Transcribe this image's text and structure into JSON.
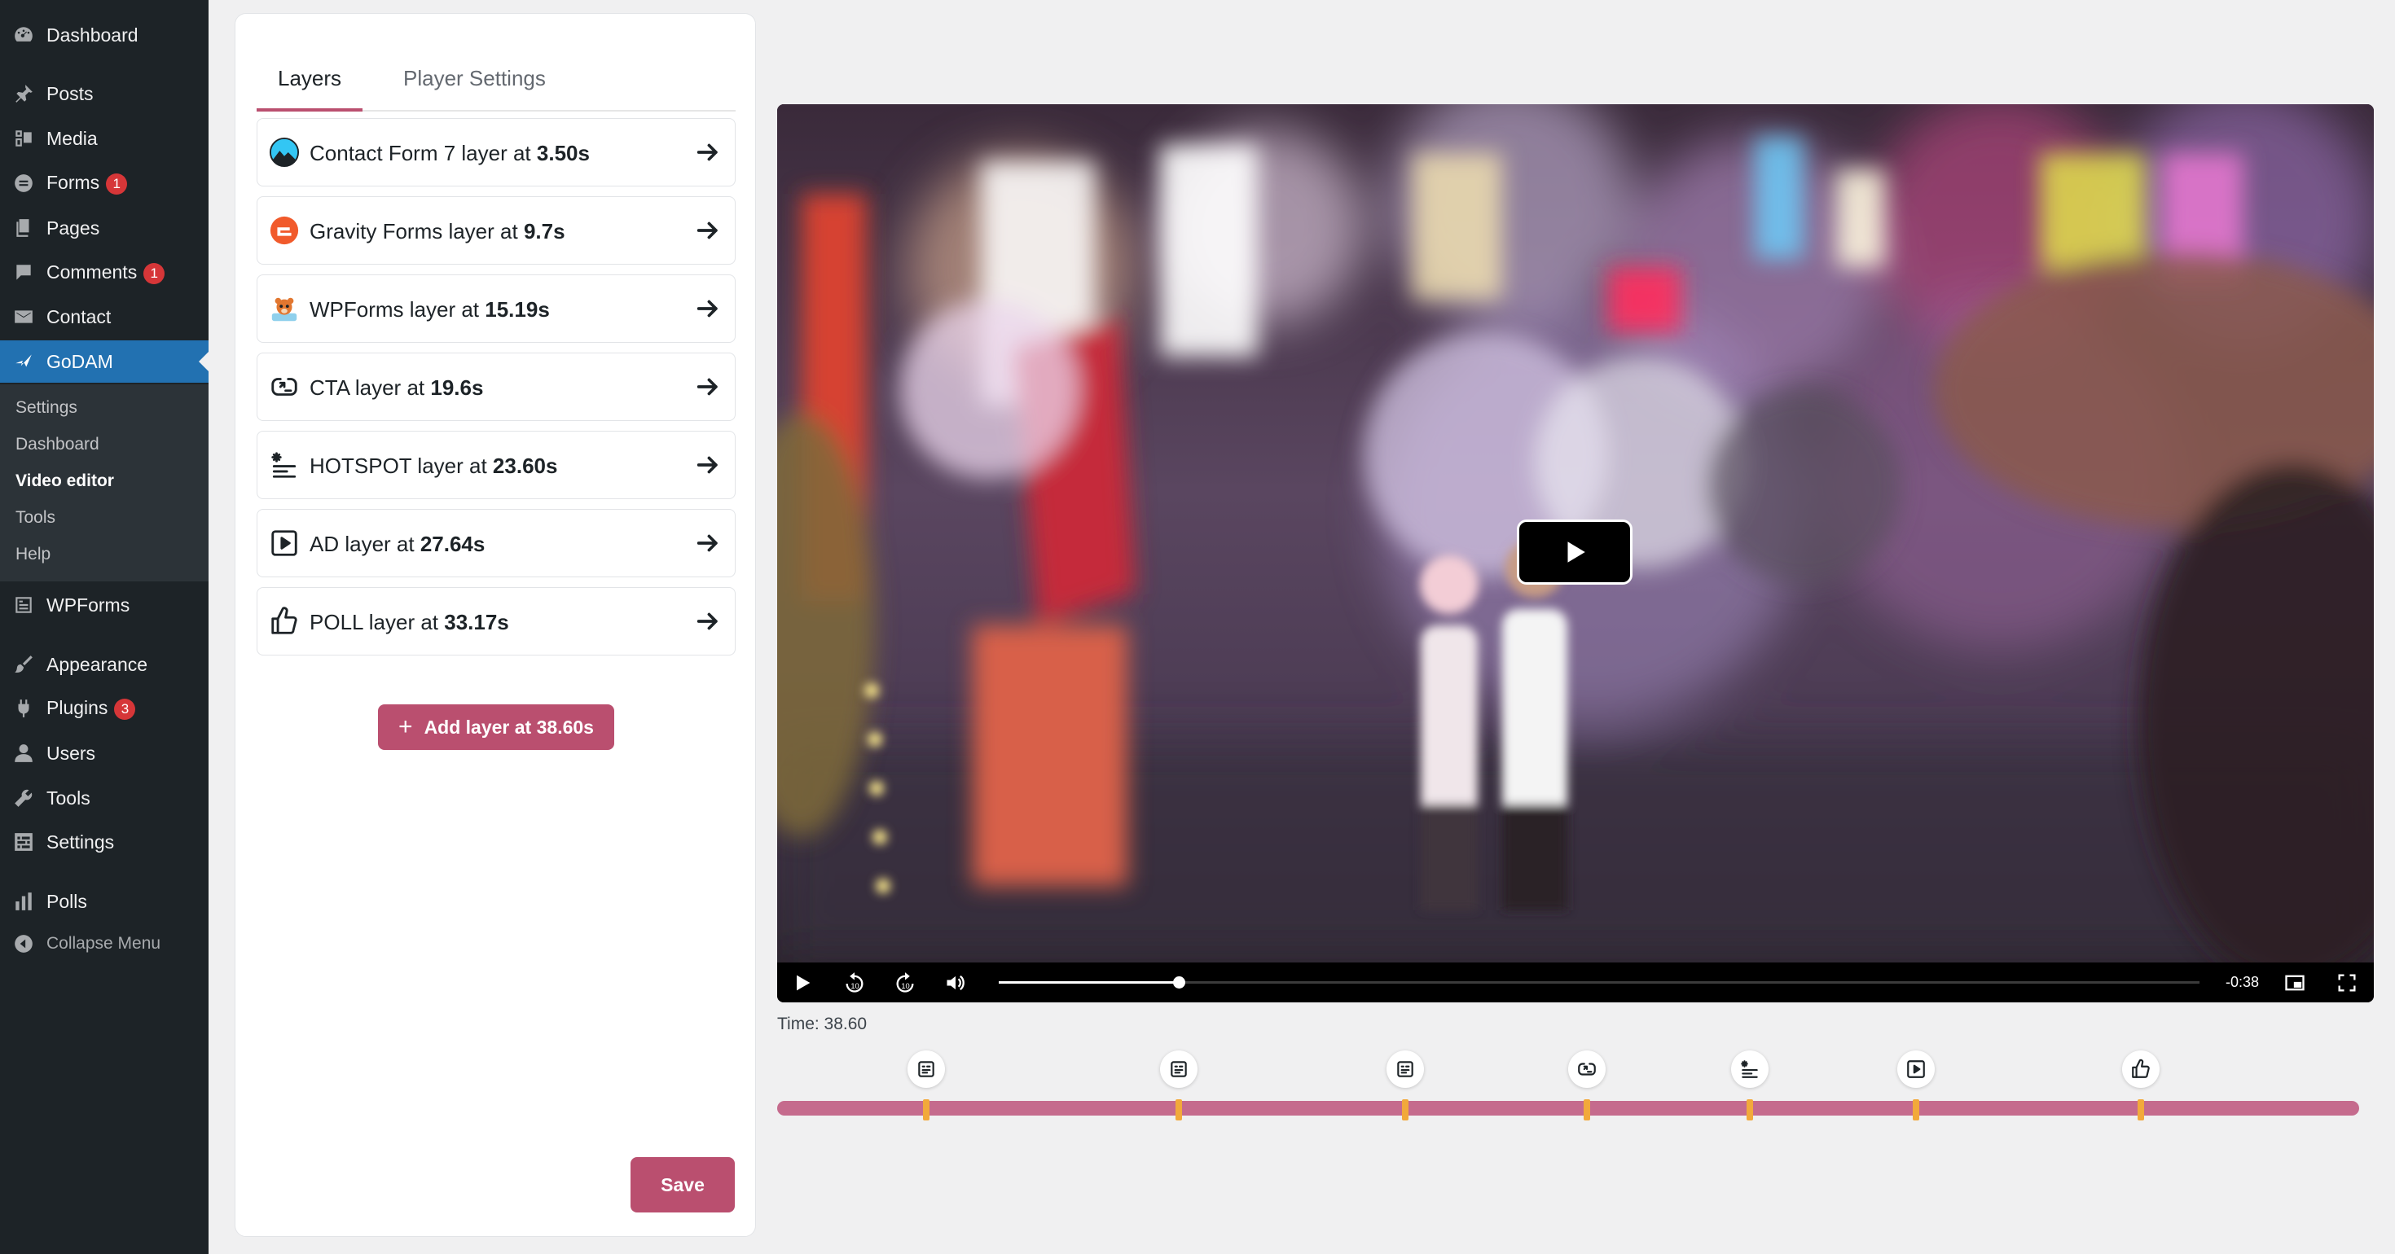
{
  "sidebar": {
    "items": [
      {
        "label": "Dashboard",
        "icon": "dashboard-icon"
      },
      {
        "label": "Posts",
        "icon": "pin-icon"
      },
      {
        "label": "Media",
        "icon": "media-icon"
      },
      {
        "label": "Forms",
        "icon": "forms-icon",
        "badge": "1"
      },
      {
        "label": "Pages",
        "icon": "pages-icon"
      },
      {
        "label": "Comments",
        "icon": "comment-icon",
        "badge": "1"
      },
      {
        "label": "Contact",
        "icon": "mail-icon"
      },
      {
        "label": "GoDAM",
        "icon": "godam-icon"
      },
      {
        "label": "WPForms",
        "icon": "wpforms-icon"
      },
      {
        "label": "Appearance",
        "icon": "brush-icon"
      },
      {
        "label": "Plugins",
        "icon": "plugin-icon",
        "badge": "3"
      },
      {
        "label": "Users",
        "icon": "user-icon"
      },
      {
        "label": "Tools",
        "icon": "wrench-icon"
      },
      {
        "label": "Settings",
        "icon": "settings-icon"
      },
      {
        "label": "Polls",
        "icon": "bar-chart-icon"
      },
      {
        "label": "Collapse Menu",
        "icon": "collapse-icon"
      }
    ],
    "submenu": [
      "Settings",
      "Dashboard",
      "Video editor",
      "Tools",
      "Help"
    ],
    "accent_color": "#2271b1"
  },
  "tabs": [
    {
      "label": "Layers"
    },
    {
      "label": "Player Settings"
    }
  ],
  "layers": [
    {
      "prefix": "Contact Form 7 layer at ",
      "time": "3.50s",
      "icon": "contact-form-7-icon"
    },
    {
      "prefix": "Gravity Forms layer at ",
      "time": "9.7s",
      "icon": "gravity-forms-icon"
    },
    {
      "prefix": "WPForms layer at ",
      "time": "15.19s",
      "icon": "wpforms-bear-icon"
    },
    {
      "prefix": "CTA layer at ",
      "time": "19.6s",
      "icon": "cta-icon"
    },
    {
      "prefix": "HOTSPOT layer at ",
      "time": "23.60s",
      "icon": "hotspot-icon"
    },
    {
      "prefix": "AD layer at ",
      "time": "27.64s",
      "icon": "ad-play-icon"
    },
    {
      "prefix": "POLL layer at ",
      "time": "33.17s",
      "icon": "thumbs-up-icon"
    }
  ],
  "add_layer_label": "Add layer at 38.60s",
  "save_label": "Save",
  "brand_color": "#ba4f6f",
  "player": {
    "remaining": "-0:38",
    "progress_fraction": 0.15
  },
  "time_text": "Time: 38.60",
  "timeline": {
    "duration_fraction_markers": [
      0.094,
      0.254,
      0.397,
      0.512,
      0.615,
      0.72,
      0.862
    ],
    "marker_icons": [
      "form-icon",
      "form-icon",
      "form-icon",
      "cta-icon",
      "hotspot-icon",
      "ad-play-icon",
      "thumbs-up-icon"
    ]
  }
}
